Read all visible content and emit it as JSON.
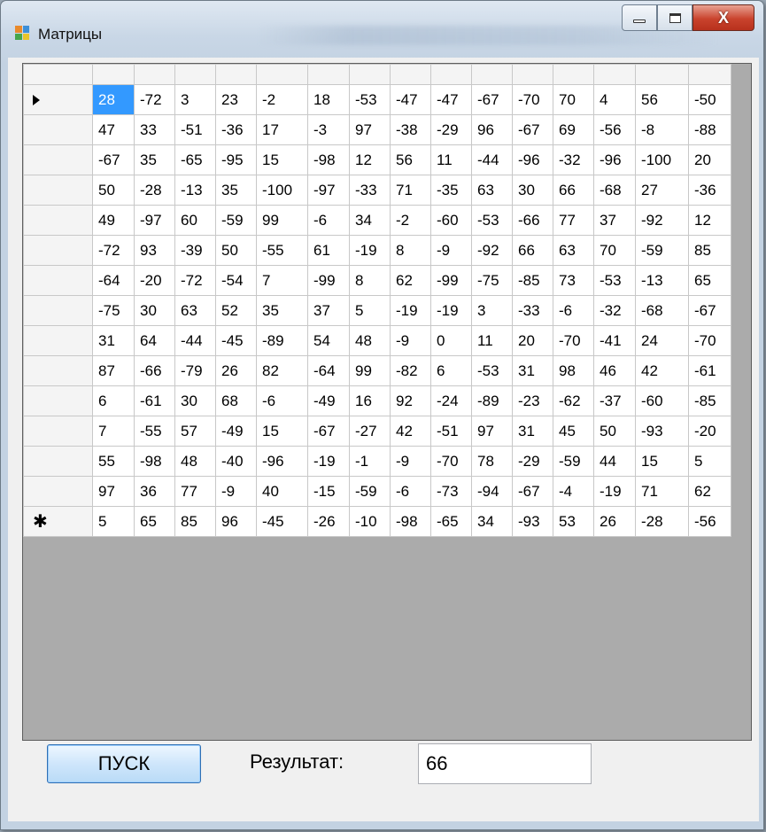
{
  "window": {
    "title": "Матрицы"
  },
  "grid": {
    "row_marker_current": "▶",
    "row_marker_new": "✱",
    "column_count": 15,
    "selected_cell": {
      "row": 0,
      "col": 0
    },
    "rows": [
      [
        "28",
        "-72",
        "3",
        "23",
        "-2",
        "18",
        "-53",
        "-47",
        "-47",
        "-67",
        "-70",
        "70",
        "4",
        "56",
        "-50"
      ],
      [
        "47",
        "33",
        "-51",
        "-36",
        "17",
        "-3",
        "97",
        "-38",
        "-29",
        "96",
        "-67",
        "69",
        "-56",
        "-8",
        "-88"
      ],
      [
        "-67",
        "35",
        "-65",
        "-95",
        "15",
        "-98",
        "12",
        "56",
        "11",
        "-44",
        "-96",
        "-32",
        "-96",
        "-100",
        "20"
      ],
      [
        "50",
        "-28",
        "-13",
        "35",
        "-100",
        "-97",
        "-33",
        "71",
        "-35",
        "63",
        "30",
        "66",
        "-68",
        "27",
        "-36"
      ],
      [
        "49",
        "-97",
        "60",
        "-59",
        "99",
        "-6",
        "34",
        "-2",
        "-60",
        "-53",
        "-66",
        "77",
        "37",
        "-92",
        "12"
      ],
      [
        "-72",
        "93",
        "-39",
        "50",
        "-55",
        "61",
        "-19",
        "8",
        "-9",
        "-92",
        "66",
        "63",
        "70",
        "-59",
        "85"
      ],
      [
        "-64",
        "-20",
        "-72",
        "-54",
        "7",
        "-99",
        "8",
        "62",
        "-99",
        "-75",
        "-85",
        "73",
        "-53",
        "-13",
        "65"
      ],
      [
        "-75",
        "30",
        "63",
        "52",
        "35",
        "37",
        "5",
        "-19",
        "-19",
        "3",
        "-33",
        "-6",
        "-32",
        "-68",
        "-67"
      ],
      [
        "31",
        "64",
        "-44",
        "-45",
        "-89",
        "54",
        "48",
        "-9",
        "0",
        "11",
        "20",
        "-70",
        "-41",
        "24",
        "-70"
      ],
      [
        "87",
        "-66",
        "-79",
        "26",
        "82",
        "-64",
        "99",
        "-82",
        "6",
        "-53",
        "31",
        "98",
        "46",
        "42",
        "-61"
      ],
      [
        "6",
        "-61",
        "30",
        "68",
        "-6",
        "-49",
        "16",
        "92",
        "-24",
        "-89",
        "-23",
        "-62",
        "-37",
        "-60",
        "-85"
      ],
      [
        "7",
        "-55",
        "57",
        "-49",
        "15",
        "-67",
        "-27",
        "42",
        "-51",
        "97",
        "31",
        "45",
        "50",
        "-93",
        "-20"
      ],
      [
        "55",
        "-98",
        "48",
        "-40",
        "-96",
        "-19",
        "-1",
        "-9",
        "-70",
        "78",
        "-29",
        "-59",
        "44",
        "15",
        "5"
      ],
      [
        "97",
        "36",
        "77",
        "-9",
        "40",
        "-15",
        "-59",
        "-6",
        "-73",
        "-94",
        "-67",
        "-4",
        "-19",
        "71",
        "62"
      ],
      [
        "5",
        "65",
        "85",
        "96",
        "-45",
        "-26",
        "-10",
        "-98",
        "-65",
        "34",
        "-93",
        "53",
        "26",
        "-28",
        "-56"
      ]
    ]
  },
  "controls": {
    "start_button": "ПУСК",
    "result_label": "Результат:",
    "result_value": "66"
  },
  "colors": {
    "selection": "#3399ff",
    "grid_background": "#ababab",
    "close_button": "#c9432d"
  }
}
